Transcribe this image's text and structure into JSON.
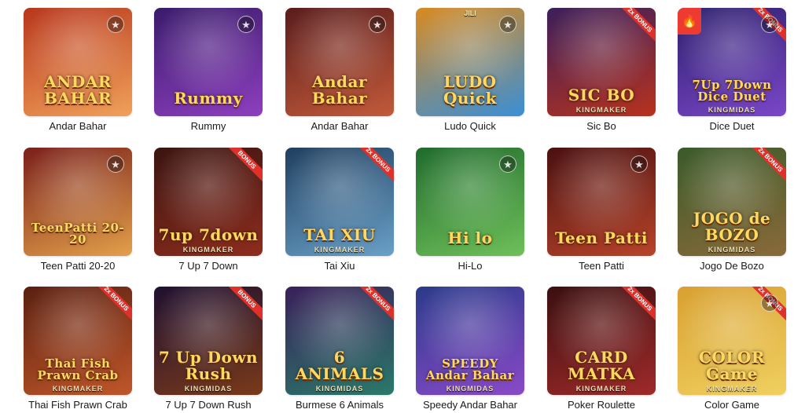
{
  "games": [
    {
      "name": "Andar Bahar",
      "logo": "ANDAR BAHAR",
      "brand": "",
      "badge": "",
      "top": "",
      "bg": [
        "#b8361c",
        "#f0a15a"
      ],
      "fav": true
    },
    {
      "name": "Rummy",
      "logo": "Rummy",
      "brand": "",
      "badge": "",
      "top": "",
      "bg": [
        "#3a1b6b",
        "#8e3fbf"
      ],
      "fav": true
    },
    {
      "name": "Andar Bahar",
      "logo": "Andar Bahar",
      "brand": "",
      "badge": "",
      "top": "",
      "bg": [
        "#5a1c1c",
        "#c35a3a"
      ],
      "fav": true
    },
    {
      "name": "Ludo Quick",
      "logo": "LUDO Quick",
      "brand": "",
      "badge": "",
      "top": "JILI",
      "bg": [
        "#d98a1f",
        "#3a8fd6"
      ],
      "fav": true
    },
    {
      "name": "Sic Bo",
      "logo": "SIC BO",
      "brand": "KINGMAKER",
      "badge": "2x BONUS",
      "top": "",
      "bg": [
        "#3b1f5a",
        "#b8321e"
      ],
      "fav": false
    },
    {
      "name": "Dice Duet",
      "logo": "7Up 7Down Dice Duet",
      "brand": "KINGMIDAS",
      "badge": "2x BONUS",
      "top": "",
      "bg": [
        "#2b1f6b",
        "#7b47c9"
      ],
      "fav": true,
      "hot": true
    },
    {
      "name": "Teen Patti 20-20",
      "logo": "TeenPatti 20-20",
      "brand": "",
      "badge": "",
      "top": "",
      "bg": [
        "#7a1f1a",
        "#e3a04a"
      ],
      "fav": true
    },
    {
      "name": "7 Up 7 Down",
      "logo": "7up 7down",
      "brand": "KINGMAKER",
      "badge": "BONUS",
      "top": "",
      "bg": [
        "#3a1410",
        "#8e2d1e"
      ],
      "fav": false
    },
    {
      "name": "Tai Xiu",
      "logo": "TAI XIU",
      "brand": "KINGMAKER",
      "badge": "2x BONUS",
      "top": "",
      "bg": [
        "#1f3f5f",
        "#6aa0c8"
      ],
      "fav": false
    },
    {
      "name": "Hi-Lo",
      "logo": "Hi lo",
      "brand": "",
      "badge": "",
      "top": "",
      "bg": [
        "#1f6b2c",
        "#6fc05a"
      ],
      "fav": true
    },
    {
      "name": "Teen Patti",
      "logo": "Teen Patti",
      "brand": "",
      "badge": "",
      "top": "",
      "bg": [
        "#4a1010",
        "#b8442a"
      ],
      "fav": true
    },
    {
      "name": "Jogo De Bozo",
      "logo": "JOGO de BOZO",
      "brand": "KINGMIDAS",
      "badge": "2x BONUS",
      "top": "",
      "bg": [
        "#3a5a2a",
        "#8a6a3a"
      ],
      "fav": false
    },
    {
      "name": "Thai Fish Prawn Crab",
      "logo": "Thai Fish Prawn Crab",
      "brand": "KINGMAKER",
      "badge": "2x BONUS",
      "top": "",
      "bg": [
        "#5a1f10",
        "#c0572a"
      ],
      "fav": false
    },
    {
      "name": "7 Up 7 Down Rush",
      "logo": "7 Up Down Rush",
      "brand": "KINGMIDAS",
      "badge": "BONUS",
      "top": "",
      "bg": [
        "#1f1030",
        "#7a3a1a"
      ],
      "fav": false
    },
    {
      "name": "Burmese 6 Animals",
      "logo": "6 ANIMALS",
      "brand": "KINGMIDAS",
      "badge": "2x BONUS",
      "top": "",
      "bg": [
        "#3a1f5a",
        "#2a7a6a"
      ],
      "fav": false
    },
    {
      "name": "Speedy Andar Bahar",
      "logo": "SPEEDY Andar Bahar",
      "brand": "KINGMIDAS",
      "badge": "",
      "top": "",
      "bg": [
        "#2a3a8a",
        "#8a4ac8"
      ],
      "fav": false
    },
    {
      "name": "Poker Roulette",
      "logo": "CARD MATKA",
      "brand": "KINGMAKER",
      "badge": "2x BONUS",
      "top": "",
      "bg": [
        "#3a0f10",
        "#a02a2a"
      ],
      "fav": false
    },
    {
      "name": "Color Game",
      "logo": "COLOR Game",
      "brand": "KINGMAKER",
      "badge": "2x BONUS",
      "top": "",
      "bg": [
        "#d8a030",
        "#f0d060"
      ],
      "fav": true
    }
  ]
}
